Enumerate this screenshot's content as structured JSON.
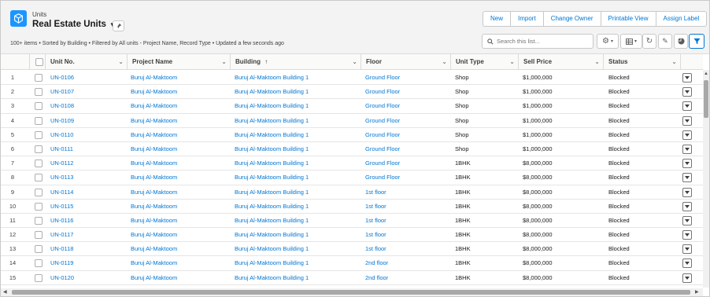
{
  "header": {
    "object_label": "Units",
    "list_title": "Real Estate Units",
    "meta": "100+ items • Sorted by Building • Filtered by All units - Project Name, Record Type • Updated a few seconds ago",
    "actions": [
      "New",
      "Import",
      "Change Owner",
      "Printable View",
      "Assign Label"
    ],
    "search_placeholder": "Search this list..."
  },
  "columns": [
    "Unit No.",
    "Project Name",
    "Building",
    "Floor",
    "Unit Type",
    "Sell Price",
    "Status"
  ],
  "sort_indicator": "↑",
  "rows": [
    {
      "n": "1",
      "unit": "UN-0106",
      "project": "Buruj Al-Maktoom",
      "building": "Buruj Al-Maktoom Building 1",
      "floor": "Ground Floor",
      "type": "Shop",
      "price": "$1,000,000",
      "status": "Blocked"
    },
    {
      "n": "2",
      "unit": "UN-0107",
      "project": "Buruj Al-Maktoom",
      "building": "Buruj Al-Maktoom Building 1",
      "floor": "Ground Floor",
      "type": "Shop",
      "price": "$1,000,000",
      "status": "Blocked"
    },
    {
      "n": "3",
      "unit": "UN-0108",
      "project": "Buruj Al-Maktoom",
      "building": "Buruj Al-Maktoom Building 1",
      "floor": "Ground Floor",
      "type": "Shop",
      "price": "$1,000,000",
      "status": "Blocked"
    },
    {
      "n": "4",
      "unit": "UN-0109",
      "project": "Buruj Al-Maktoom",
      "building": "Buruj Al-Maktoom Building 1",
      "floor": "Ground Floor",
      "type": "Shop",
      "price": "$1,000,000",
      "status": "Blocked"
    },
    {
      "n": "5",
      "unit": "UN-0110",
      "project": "Buruj Al-Maktoom",
      "building": "Buruj Al-Maktoom Building 1",
      "floor": "Ground Floor",
      "type": "Shop",
      "price": "$1,000,000",
      "status": "Blocked"
    },
    {
      "n": "6",
      "unit": "UN-0111",
      "project": "Buruj Al-Maktoom",
      "building": "Buruj Al-Maktoom Building 1",
      "floor": "Ground Floor",
      "type": "Shop",
      "price": "$1,000,000",
      "status": "Blocked"
    },
    {
      "n": "7",
      "unit": "UN-0112",
      "project": "Buruj Al-Maktoom",
      "building": "Buruj Al-Maktoom Building 1",
      "floor": "Ground Floor",
      "type": "1BHK",
      "price": "$8,000,000",
      "status": "Blocked"
    },
    {
      "n": "8",
      "unit": "UN-0113",
      "project": "Buruj Al-Maktoom",
      "building": "Buruj Al-Maktoom Building 1",
      "floor": "Ground Floor",
      "type": "1BHK",
      "price": "$8,000,000",
      "status": "Blocked"
    },
    {
      "n": "9",
      "unit": "UN-0114",
      "project": "Buruj Al-Maktoom",
      "building": "Buruj Al-Maktoom Building 1",
      "floor": "1st floor",
      "type": "1BHK",
      "price": "$8,000,000",
      "status": "Blocked"
    },
    {
      "n": "10",
      "unit": "UN-0115",
      "project": "Buruj Al-Maktoom",
      "building": "Buruj Al-Maktoom Building 1",
      "floor": "1st floor",
      "type": "1BHK",
      "price": "$8,000,000",
      "status": "Blocked"
    },
    {
      "n": "11",
      "unit": "UN-0116",
      "project": "Buruj Al-Maktoom",
      "building": "Buruj Al-Maktoom Building 1",
      "floor": "1st floor",
      "type": "1BHK",
      "price": "$8,000,000",
      "status": "Blocked"
    },
    {
      "n": "12",
      "unit": "UN-0117",
      "project": "Buruj Al-Maktoom",
      "building": "Buruj Al-Maktoom Building 1",
      "floor": "1st floor",
      "type": "1BHK",
      "price": "$8,000,000",
      "status": "Blocked"
    },
    {
      "n": "13",
      "unit": "UN-0118",
      "project": "Buruj Al-Maktoom",
      "building": "Buruj Al-Maktoom Building 1",
      "floor": "1st floor",
      "type": "1BHK",
      "price": "$8,000,000",
      "status": "Blocked"
    },
    {
      "n": "14",
      "unit": "UN-0119",
      "project": "Buruj Al-Maktoom",
      "building": "Buruj Al-Maktoom Building 1",
      "floor": "2nd floor",
      "type": "1BHK",
      "price": "$8,000,000",
      "status": "Blocked"
    },
    {
      "n": "15",
      "unit": "UN-0120",
      "project": "Buruj Al-Maktoom",
      "building": "Buruj Al-Maktoom Building 1",
      "floor": "2nd floor",
      "type": "1BHK",
      "price": "$8,000,000",
      "status": "Blocked"
    }
  ],
  "icons": {
    "object": "cube-icon",
    "pin": "pin-icon",
    "search": "search-icon",
    "settings": "gear-icon",
    "display": "table-icon",
    "refresh": "refresh-icon",
    "edit": "pencil-icon",
    "chart": "pie-chart-icon",
    "filter": "filter-icon"
  },
  "colors": {
    "brand": "#1b96ff",
    "link": "#0176d3"
  }
}
